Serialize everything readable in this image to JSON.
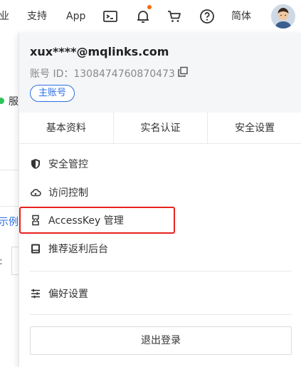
{
  "topnav": {
    "partial_item": "业",
    "support": "支持",
    "app": "App",
    "language": "简体",
    "icons": [
      "terminal-icon",
      "bell-icon",
      "cart-icon",
      "help-icon"
    ],
    "notification_dot_color": "#ff6a00"
  },
  "background": {
    "status_text": "服",
    "link_text": "示例",
    "label_text": ":"
  },
  "account": {
    "email": "xux****@mqlinks.com",
    "id_label": "账号 ID：1308474760870473",
    "badge": "主账号"
  },
  "tabs": [
    "基本资料",
    "实名认证",
    "安全设置"
  ],
  "menu": {
    "security_control": "安全管控",
    "access_control": "访问控制",
    "accesskey": "AccessKey 管理",
    "referral": "推荐返利后台",
    "preferences": "偏好设置"
  },
  "logout_label": "退出登录",
  "colors": {
    "accent": "#2e6fe4",
    "highlight_border": "#e8231e",
    "status_green": "#2ec45a"
  }
}
